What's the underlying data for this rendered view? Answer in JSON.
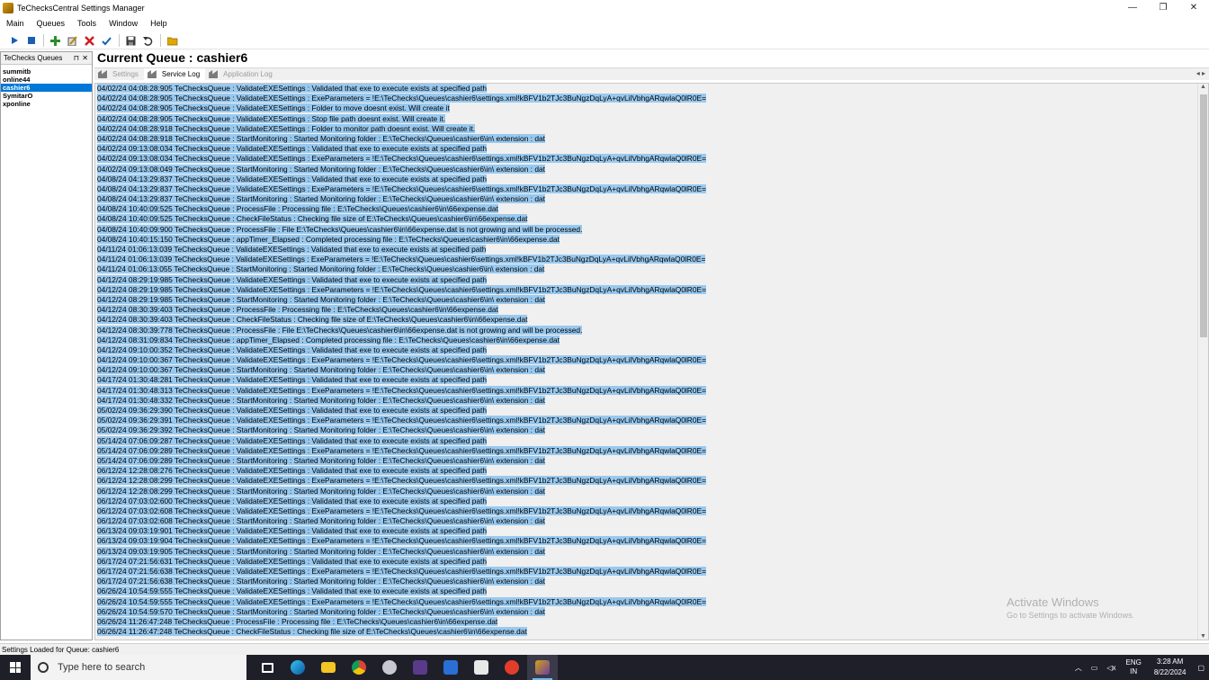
{
  "window": {
    "title": "TeChecksCentral Settings Manager",
    "controls": [
      "—",
      "❐",
      "✕"
    ]
  },
  "menu": [
    "Main",
    "Queues",
    "Tools",
    "Window",
    "Help"
  ],
  "toolbar_icons": [
    "play-icon",
    "stop-icon",
    "add-icon",
    "edit-icon",
    "delete-icon",
    "check-icon",
    "save-icon",
    "undo-icon",
    "open-folder-icon"
  ],
  "queues_panel": {
    "title": "TeChecks Queues",
    "pin": "⊓",
    "close": "✕",
    "items": [
      "summitb",
      "online44",
      "cashier6",
      "SymitarO",
      "xponline"
    ],
    "selected_index": 2
  },
  "main": {
    "title": "Current Queue : cashier6",
    "tabs": [
      "Settings",
      "Service Log",
      "Application Log"
    ],
    "active_tab": 1
  },
  "log_lines": [
    "04/02/24 04:08:28:905 TeChecksQueue : ValidateEXESettings : Validated that exe to execute exists at specified path",
    "04/02/24 04:08:28:905 TeChecksQueue : ValidateEXESettings : ExeParameters = !E:\\TeChecks\\Queues\\cashier6\\settings.xml!kBFV1b2TJc3BuNgzDqLyA+qvLilVbhgARqwlaQ0lR0E=",
    "04/02/24 04:08:28:905 TeChecksQueue : ValidateEXESettings : Folder to move doesnt exist. Will create it",
    "04/02/24 04:08:28:905 TeChecksQueue : ValidateEXESettings : Stop file path doesnt exist. Will create it.",
    "04/02/24 04:08:28:918 TeChecksQueue : ValidateEXESettings : Folder to monitor path doesnt exist. Will create it.",
    "04/02/24 04:08:28:918 TeChecksQueue : StartMonitoring : Started Monitoring folder : E:\\TeChecks\\Queues\\cashier6\\in\\ extension : dat",
    "04/02/24 09:13:08:034 TeChecksQueue : ValidateEXESettings : Validated that exe to execute exists at specified path",
    "04/02/24 09:13:08:034 TeChecksQueue : ValidateEXESettings : ExeParameters = !E:\\TeChecks\\Queues\\cashier6\\settings.xml!kBFV1b2TJc3BuNgzDqLyA+qvLilVbhgARqwlaQ0lR0E=",
    "04/02/24 09:13:08:049 TeChecksQueue : StartMonitoring : Started Monitoring folder : E:\\TeChecks\\Queues\\cashier6\\in\\ extension : dat",
    "04/08/24 04:13:29:837 TeChecksQueue : ValidateEXESettings : Validated that exe to execute exists at specified path",
    "04/08/24 04:13:29:837 TeChecksQueue : ValidateEXESettings : ExeParameters = !E:\\TeChecks\\Queues\\cashier6\\settings.xml!kBFV1b2TJc3BuNgzDqLyA+qvLilVbhgARqwlaQ0lR0E=",
    "04/08/24 04:13:29:837 TeChecksQueue : StartMonitoring : Started Monitoring folder : E:\\TeChecks\\Queues\\cashier6\\in\\ extension : dat",
    "04/08/24 10:40:09:525 TeChecksQueue : ProcessFile : Processing file : E:\\TeChecks\\Queues\\cashier6\\in\\66expense.dat",
    "04/08/24 10:40:09:525 TeChecksQueue : CheckFileStatus : Checking file size of E:\\TeChecks\\Queues\\cashier6\\in\\66expense.dat",
    "04/08/24 10:40:09:900 TeChecksQueue : ProcessFile : File E:\\TeChecks\\Queues\\cashier6\\in\\66expense.dat is not growing and will be processed.",
    "04/08/24 10:40:15:150 TeChecksQueue : appTimer_Elapsed : Completed processing file : E:\\TeChecks\\Queues\\cashier6\\in\\66expense.dat",
    "04/11/24 01:06:13:039 TeChecksQueue : ValidateEXESettings : Validated that exe to execute exists at specified path",
    "04/11/24 01:06:13:039 TeChecksQueue : ValidateEXESettings : ExeParameters = !E:\\TeChecks\\Queues\\cashier6\\settings.xml!kBFV1b2TJc3BuNgzDqLyA+qvLilVbhgARqwlaQ0lR0E=",
    "04/11/24 01:06:13:055 TeChecksQueue : StartMonitoring : Started Monitoring folder : E:\\TeChecks\\Queues\\cashier6\\in\\ extension : dat",
    "04/12/24 08:29:19:985 TeChecksQueue : ValidateEXESettings : Validated that exe to execute exists at specified path",
    "04/12/24 08:29:19:985 TeChecksQueue : ValidateEXESettings : ExeParameters = !E:\\TeChecks\\Queues\\cashier6\\settings.xml!kBFV1b2TJc3BuNgzDqLyA+qvLilVbhgARqwlaQ0lR0E=",
    "04/12/24 08:29:19:985 TeChecksQueue : StartMonitoring : Started Monitoring folder : E:\\TeChecks\\Queues\\cashier6\\in\\ extension : dat",
    "04/12/24 08:30:39:403 TeChecksQueue : ProcessFile : Processing file : E:\\TeChecks\\Queues\\cashier6\\in\\66expense.dat",
    "04/12/24 08:30:39:403 TeChecksQueue : CheckFileStatus : Checking file size of E:\\TeChecks\\Queues\\cashier6\\in\\66expense.dat",
    "04/12/24 08:30:39:778 TeChecksQueue : ProcessFile : File E:\\TeChecks\\Queues\\cashier6\\in\\66expense.dat is not growing and will be processed.",
    "04/12/24 08:31:09:834 TeChecksQueue : appTimer_Elapsed : Completed processing file : E:\\TeChecks\\Queues\\cashier6\\in\\66expense.dat",
    "04/12/24 09:10:00:352 TeChecksQueue : ValidateEXESettings : Validated that exe to execute exists at specified path",
    "04/12/24 09:10:00:367 TeChecksQueue : ValidateEXESettings : ExeParameters = !E:\\TeChecks\\Queues\\cashier6\\settings.xml!kBFV1b2TJc3BuNgzDqLyA+qvLilVbhgARqwlaQ0lR0E=",
    "04/12/24 09:10:00:367 TeChecksQueue : StartMonitoring : Started Monitoring folder : E:\\TeChecks\\Queues\\cashier6\\in\\ extension : dat",
    "04/17/24 01:30:48:281 TeChecksQueue : ValidateEXESettings : Validated that exe to execute exists at specified path",
    "04/17/24 01:30:48:313 TeChecksQueue : ValidateEXESettings : ExeParameters = !E:\\TeChecks\\Queues\\cashier6\\settings.xml!kBFV1b2TJc3BuNgzDqLyA+qvLilVbhgARqwlaQ0lR0E=",
    "04/17/24 01:30:48:332 TeChecksQueue : StartMonitoring : Started Monitoring folder : E:\\TeChecks\\Queues\\cashier6\\in\\ extension : dat",
    "05/02/24 09:36:29:390 TeChecksQueue : ValidateEXESettings : Validated that exe to execute exists at specified path",
    "05/02/24 09:36:29:391 TeChecksQueue : ValidateEXESettings : ExeParameters = !E:\\TeChecks\\Queues\\cashier6\\settings.xml!kBFV1b2TJc3BuNgzDqLyA+qvLilVbhgARqwlaQ0lR0E=",
    "05/02/24 09:36:29:392 TeChecksQueue : StartMonitoring : Started Monitoring folder : E:\\TeChecks\\Queues\\cashier6\\in\\ extension : dat",
    "05/14/24 07:06:09:287 TeChecksQueue : ValidateEXESettings : Validated that exe to execute exists at specified path",
    "05/14/24 07:06:09:289 TeChecksQueue : ValidateEXESettings : ExeParameters = !E:\\TeChecks\\Queues\\cashier6\\settings.xml!kBFV1b2TJc3BuNgzDqLyA+qvLilVbhgARqwlaQ0lR0E=",
    "05/14/24 07:06:09:289 TeChecksQueue : StartMonitoring : Started Monitoring folder : E:\\TeChecks\\Queues\\cashier6\\in\\ extension : dat",
    "06/12/24 12:28:08:276 TeChecksQueue : ValidateEXESettings : Validated that exe to execute exists at specified path",
    "06/12/24 12:28:08:299 TeChecksQueue : ValidateEXESettings : ExeParameters = !E:\\TeChecks\\Queues\\cashier6\\settings.xml!kBFV1b2TJc3BuNgzDqLyA+qvLilVbhgARqwlaQ0lR0E=",
    "06/12/24 12:28:08:299 TeChecksQueue : StartMonitoring : Started Monitoring folder : E:\\TeChecks\\Queues\\cashier6\\in\\ extension : dat",
    "06/12/24 07:03:02:600 TeChecksQueue : ValidateEXESettings : Validated that exe to execute exists at specified path",
    "06/12/24 07:03:02:608 TeChecksQueue : ValidateEXESettings : ExeParameters = !E:\\TeChecks\\Queues\\cashier6\\settings.xml!kBFV1b2TJc3BuNgzDqLyA+qvLilVbhgARqwlaQ0lR0E=",
    "06/12/24 07:03:02:608 TeChecksQueue : StartMonitoring : Started Monitoring folder : E:\\TeChecks\\Queues\\cashier6\\in\\ extension : dat",
    "06/13/24 09:03:19:901 TeChecksQueue : ValidateEXESettings : Validated that exe to execute exists at specified path",
    "06/13/24 09:03:19:904 TeChecksQueue : ValidateEXESettings : ExeParameters = !E:\\TeChecks\\Queues\\cashier6\\settings.xml!kBFV1b2TJc3BuNgzDqLyA+qvLilVbhgARqwlaQ0lR0E=",
    "06/13/24 09:03:19:905 TeChecksQueue : StartMonitoring : Started Monitoring folder : E:\\TeChecks\\Queues\\cashier6\\in\\ extension : dat",
    "06/17/24 07:21:56:631 TeChecksQueue : ValidateEXESettings : Validated that exe to execute exists at specified path",
    "06/17/24 07:21:56:638 TeChecksQueue : ValidateEXESettings : ExeParameters = !E:\\TeChecks\\Queues\\cashier6\\settings.xml!kBFV1b2TJc3BuNgzDqLyA+qvLilVbhgARqwlaQ0lR0E=",
    "06/17/24 07:21:56:638 TeChecksQueue : StartMonitoring : Started Monitoring folder : E:\\TeChecks\\Queues\\cashier6\\in\\ extension : dat",
    "06/26/24 10:54:59:555 TeChecksQueue : ValidateEXESettings : Validated that exe to execute exists at specified path",
    "06/26/24 10:54:59:555 TeChecksQueue : ValidateEXESettings : ExeParameters = !E:\\TeChecks\\Queues\\cashier6\\settings.xml!kBFV1b2TJc3BuNgzDqLyA+qvLilVbhgARqwlaQ0lR0E=",
    "06/26/24 10:54:59:570 TeChecksQueue : StartMonitoring : Started Monitoring folder : E:\\TeChecks\\Queues\\cashier6\\in\\ extension : dat",
    "06/26/24 11:26:47:248 TeChecksQueue : ProcessFile : Processing file : E:\\TeChecks\\Queues\\cashier6\\in\\66expense.dat",
    "06/26/24 11:26:47:248 TeChecksQueue : CheckFileStatus : Checking file size of E:\\TeChecks\\Queues\\cashier6\\in\\66expense.dat"
  ],
  "watermark": {
    "line1": "Activate Windows",
    "line2": "Go to Settings to activate Windows."
  },
  "status": "Settings Loaded for Queue: cashier6",
  "taskbar": {
    "search_placeholder": "Type here to search",
    "lang_top": "ENG",
    "lang_bottom": "IN",
    "time": "3:28 AM",
    "date": "8/22/2024"
  },
  "colors": {
    "selection": "#0078d7",
    "log_highlight": "#99c9ef",
    "taskbar": "#1f1f2a"
  }
}
